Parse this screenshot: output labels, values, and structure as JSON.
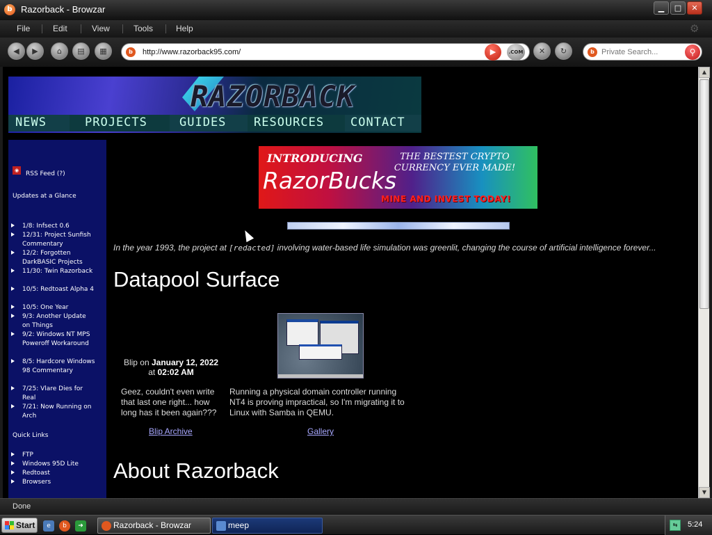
{
  "window": {
    "title": "Razorback - Browzar",
    "controls": {
      "minimize": "▁",
      "maximize": "□",
      "close": "✕"
    }
  },
  "menu": {
    "items": [
      "File",
      "Edit",
      "View",
      "Tools",
      "Help"
    ]
  },
  "toolbar": {
    "url": "http://www.razorback95.com/",
    "com_label": ".COM",
    "search_placeholder": "Private Search..."
  },
  "site": {
    "logo": "RAZORBACK",
    "nav": [
      "NEWS",
      "PROJECTS",
      "GUIDES",
      "RESOURCES",
      "CONTACT"
    ],
    "sidebar": {
      "rss": "RSS Feed (?)",
      "updates_heading": "Updates at a Glance",
      "updates": [
        "1/8: Infsect 0.6",
        "12/31: Project Sunfish Commentary",
        "12/2: Forgotten DarkBASIC Projects",
        "11/30: Twin Razorback",
        "10/5: Redtoast Alpha 4",
        "10/5: One Year",
        "9/3: Another Update on Things",
        "9/2: Windows NT MPS Poweroff Workaround",
        "8/5: Hardcore Windows 98 Commentary",
        "7/25: Vlare Dies for Real",
        "7/21: Now Running on Arch"
      ],
      "quick_heading": "Quick Links",
      "quick": [
        "FTP",
        "Windows 95D Lite",
        "Redtoast",
        "Browsers"
      ]
    },
    "ad": {
      "introducing": "INTRODUCING",
      "tagline": "THE BESTEST CRYPTO CURRENCY EVER MADE!",
      "name": "RazorBucks",
      "cta": "MINE AND INVEST TODAY!"
    },
    "intro_pre": "In the year 1993, the project at ",
    "intro_redacted": "[redacted]",
    "intro_post": " involving water-based life simulation was greenlit, changing the course of artificial intelligence forever...",
    "section1": "Datapool Surface",
    "blip": {
      "prefix": "Blip on ",
      "date": "January 12, 2022",
      "at": "at ",
      "time": "02:02 AM",
      "text": "Geez, couldn't even write that last one right... how long has it been again???",
      "archive": "Blip Archive"
    },
    "gallery": {
      "text": "Running a physical domain controller running NT4 is proving impractical, so I'm migrating it to Linux with Samba in QEMU.",
      "link": "Gallery"
    },
    "section2": "About Razorback"
  },
  "status": "Done",
  "taskbar": {
    "start": "Start",
    "tasks": [
      "Razorback - Browzar",
      "meep"
    ],
    "clock": "5:24"
  }
}
